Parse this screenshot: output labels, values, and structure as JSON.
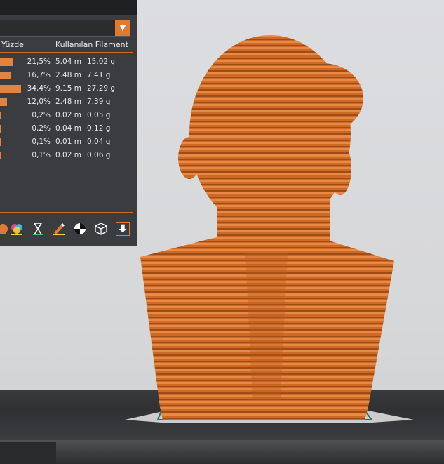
{
  "stats_table": {
    "headers": {
      "percent": "Yüzde",
      "filament": "Kullanılan Filament"
    },
    "rows": [
      {
        "percent": "21,5%",
        "length": "5.04 m",
        "weight": "15.02 g",
        "fraction": 0.215
      },
      {
        "percent": "16,7%",
        "length": "2.48 m",
        "weight": "7.41 g",
        "fraction": 0.167
      },
      {
        "percent": "34,4%",
        "length": "9.15 m",
        "weight": "27.29 g",
        "fraction": 0.344
      },
      {
        "percent": "12,0%",
        "length": "2.48 m",
        "weight": "7.39 g",
        "fraction": 0.12
      },
      {
        "percent": "0,2%",
        "length": "0.02 m",
        "weight": "0.05 g",
        "fraction": 0.002
      },
      {
        "percent": "0,2%",
        "length": "0.04 m",
        "weight": "0.12 g",
        "fraction": 0.002
      },
      {
        "percent": "0,1%",
        "length": "0.01 m",
        "weight": "0.04 g",
        "fraction": 0.001
      },
      {
        "percent": "0,1%",
        "length": "0.02 m",
        "weight": "0.06 g",
        "fraction": 0.001
      }
    ]
  },
  "combo": {
    "arrow_icon": "triangle-down-icon"
  },
  "toolbar": {
    "icons": [
      "paint-icon",
      "color-layers-icon",
      "hourglass-icon",
      "edit-pencil-icon",
      "color-wheel-icon",
      "cube-wireframe-icon",
      "export-down-icon"
    ]
  },
  "colors": {
    "accent": "#e07a33",
    "filament": "#d2691e",
    "panel": "#3b3c3f"
  }
}
